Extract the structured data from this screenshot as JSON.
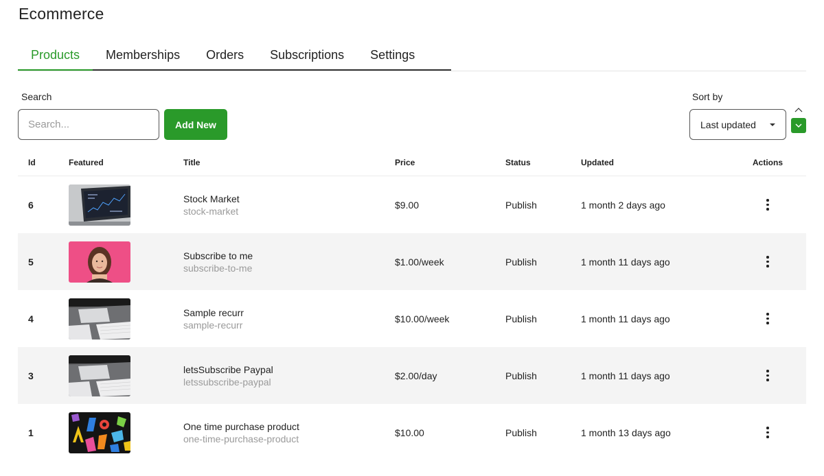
{
  "header": {
    "title": "Ecommerce"
  },
  "tabs": [
    {
      "label": "Products",
      "active": true
    },
    {
      "label": "Memberships",
      "active": false
    },
    {
      "label": "Orders",
      "active": false
    },
    {
      "label": "Subscriptions",
      "active": false
    },
    {
      "label": "Settings",
      "active": false
    }
  ],
  "toolbar": {
    "search_label": "Search",
    "search_placeholder": "Search...",
    "search_value": "",
    "add_label": "Add New",
    "sort_label": "Sort by",
    "sort_value": "Last updated",
    "sort_direction": "descending"
  },
  "table": {
    "columns": [
      "Id",
      "Featured",
      "Title",
      "Price",
      "Status",
      "Updated",
      "Actions"
    ],
    "rows": [
      {
        "id": "6",
        "title": "Stock Market",
        "slug": "stock-market",
        "price": "$9.00",
        "status": "Publish",
        "updated": "1 month 2 days ago",
        "thumb": "stock-chart-image"
      },
      {
        "id": "5",
        "title": "Subscribe to me",
        "slug": "subscribe-to-me",
        "price": "$1.00/week",
        "status": "Publish",
        "updated": "1 month 11 days ago",
        "thumb": "portrait-image"
      },
      {
        "id": "4",
        "title": "Sample recurr",
        "slug": "sample-recurr",
        "price": "$10.00/week",
        "status": "Publish",
        "updated": "1 month 11 days ago",
        "thumb": "desk-keyboard-image"
      },
      {
        "id": "3",
        "title": "letsSubscribe Paypal",
        "slug": "letssubscribe-paypal",
        "price": "$2.00/day",
        "status": "Publish",
        "updated": "1 month 11 days ago",
        "thumb": "desk-keyboard-image"
      },
      {
        "id": "1",
        "title": "One time purchase product",
        "slug": "one-time-purchase-product",
        "price": "$10.00",
        "status": "Publish",
        "updated": "1 month 13 days ago",
        "thumb": "colorful-letters-image"
      }
    ]
  },
  "colors": {
    "accent": "#2a9a2a",
    "row_alt": "#f4f4f4",
    "muted": "#9a9a9a"
  }
}
